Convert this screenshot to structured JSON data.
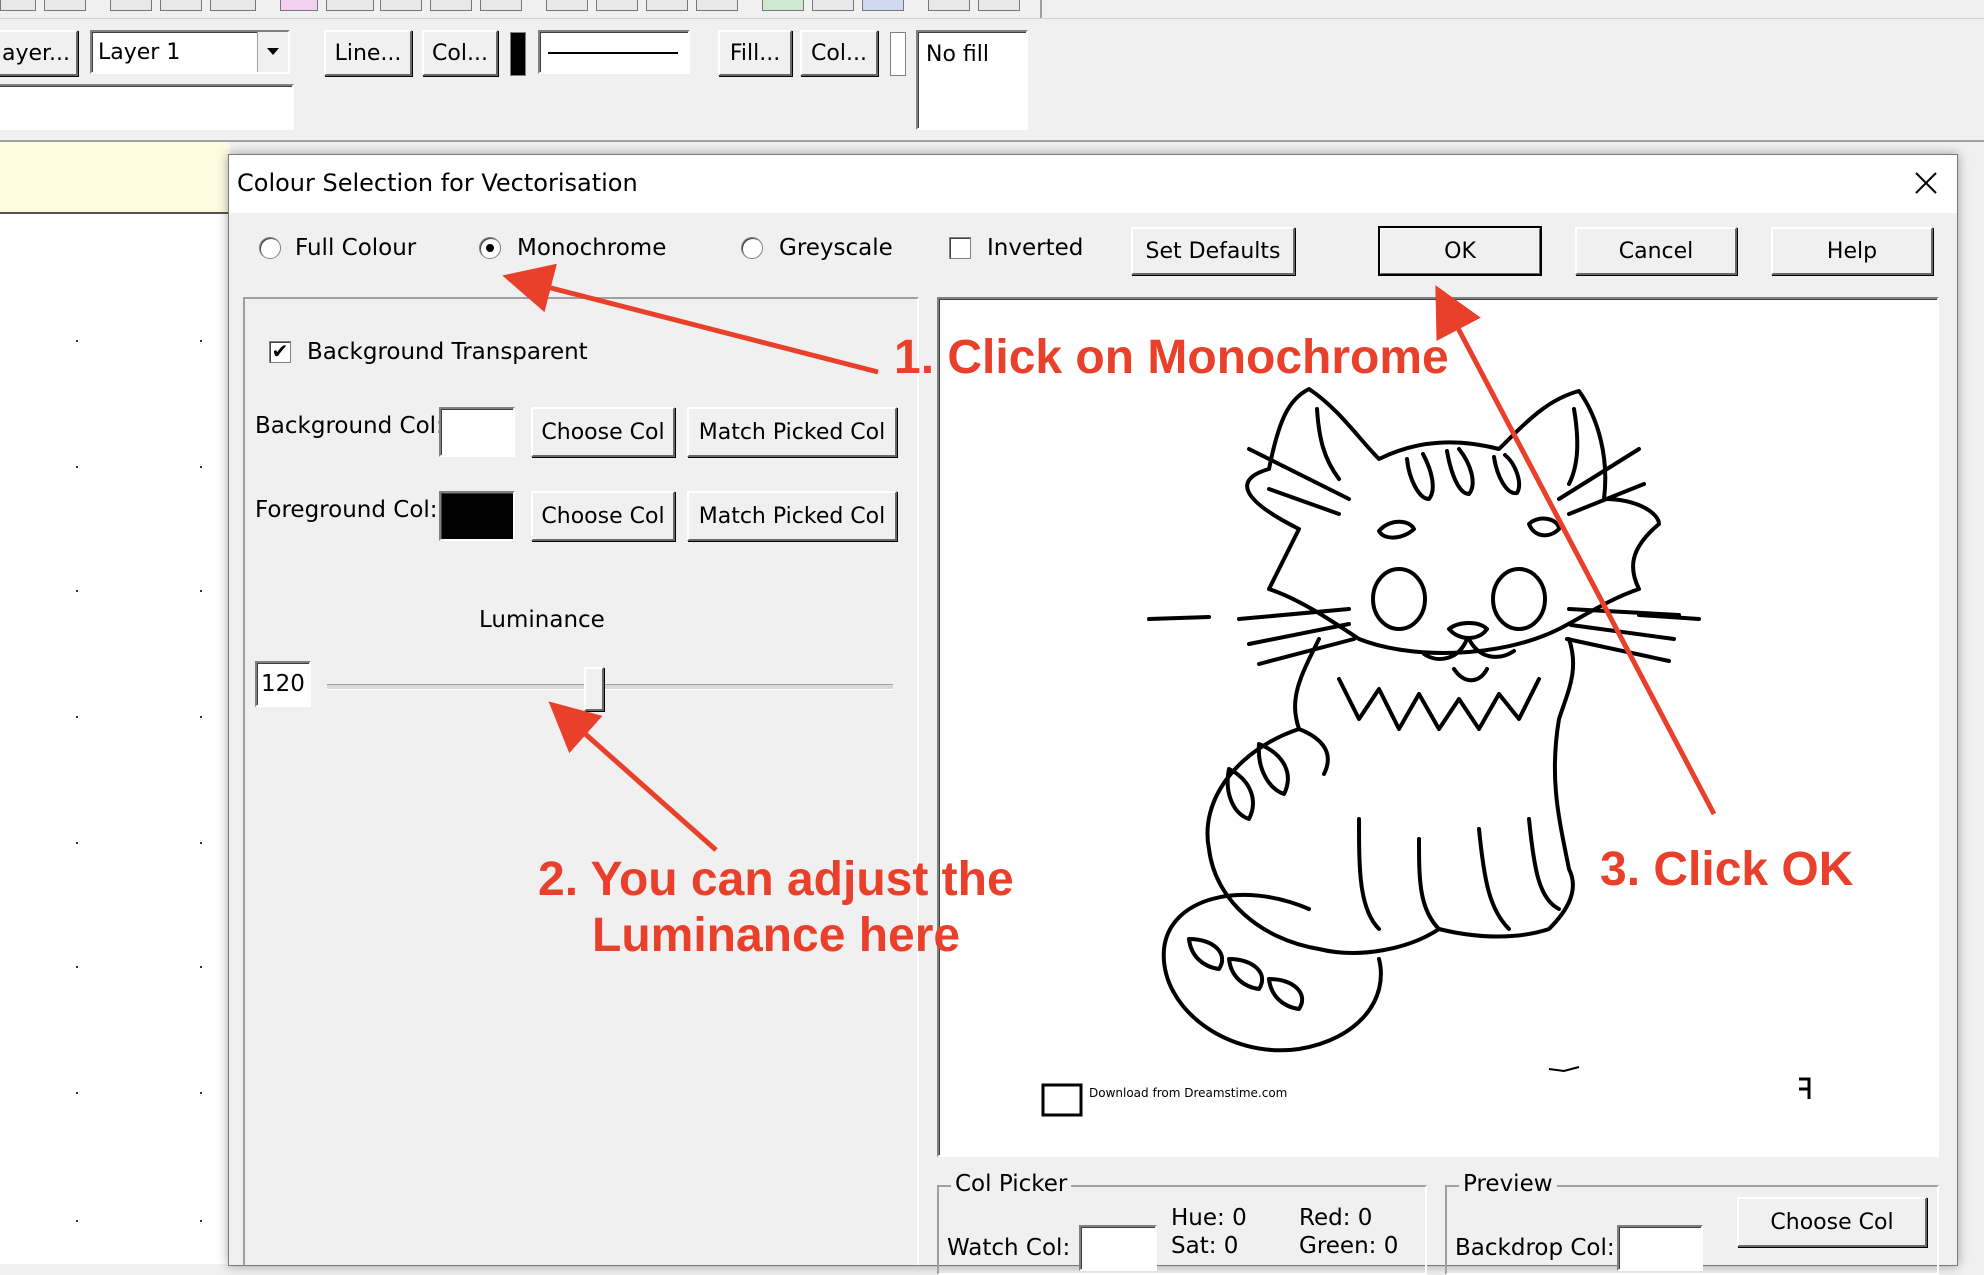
{
  "toolbar": {
    "layer_button": "ayer...",
    "layer_select": "Layer 1",
    "line_button": "Line...",
    "line_col_button": "Col...",
    "fill_button": "Fill...",
    "fill_col_button": "Col...",
    "fill_preview": "No fill"
  },
  "dialog": {
    "title": "Colour Selection for Vectorisation",
    "modes": {
      "full_colour": "Full Colour",
      "monochrome": "Monochrome",
      "greyscale": "Greyscale",
      "selected": "Monochrome"
    },
    "inverted_label": "Inverted",
    "inverted_checked": false,
    "set_defaults": "Set Defaults",
    "ok": "OK",
    "cancel": "Cancel",
    "help": "Help",
    "bg_transparent_label": "Background Transparent",
    "bg_transparent_checked": true,
    "background_col_label": "Background Col:",
    "foreground_col_label": "Foreground Col:",
    "choose_col": "Choose Col",
    "match_picked_col": "Match Picked Col",
    "background_color": "#ffffff",
    "foreground_color": "#000000",
    "luminance_label": "Luminance",
    "luminance_value": "120",
    "luminance_fraction": 0.47,
    "col_picker": {
      "title": "Col Picker",
      "watch_col_label": "Watch Col:",
      "hue": "Hue:  0",
      "sat": "Sat:  0",
      "red": "Red:   0",
      "green": "Green: 0"
    },
    "preview_group": {
      "title": "Preview",
      "backdrop_col_label": "Backdrop Col:",
      "choose_col": "Choose Col"
    },
    "preview_watermark": "Download from Dreamstime.com"
  },
  "annotations": {
    "step1": "1. Click on Monochrome",
    "step2_line1": "2. You can adjust the",
    "step2_line2": "Luminance here",
    "step3": "3. Click OK",
    "color": "#e8402a"
  }
}
